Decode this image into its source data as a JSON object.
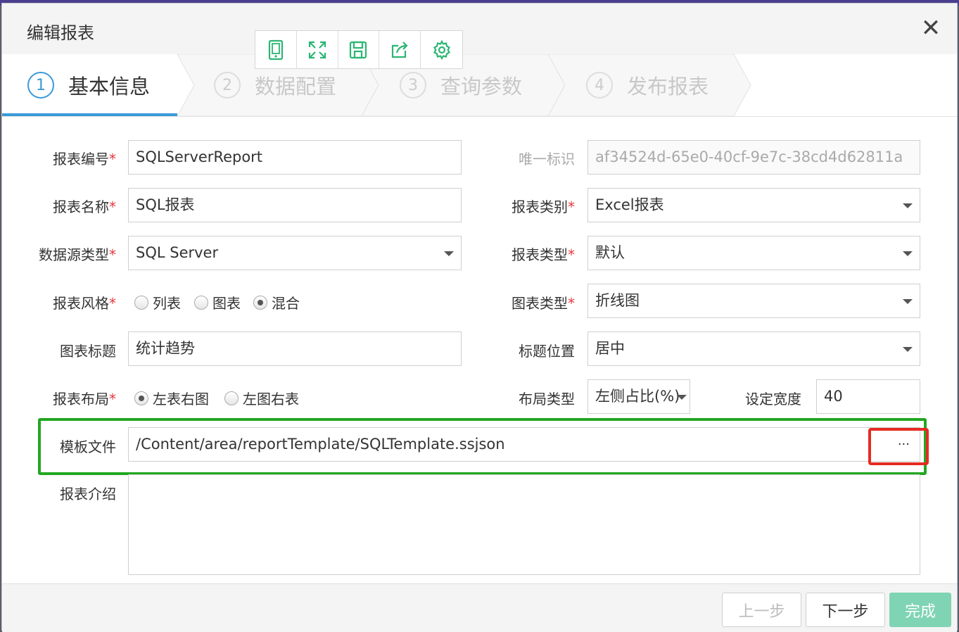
{
  "dialog": {
    "title": "编辑报表"
  },
  "toolbar": {
    "icons": [
      "tablet-icon",
      "fullscreen-icon",
      "save-icon",
      "share-icon",
      "settings-icon"
    ]
  },
  "steps": [
    {
      "num": "1",
      "label": "基本信息",
      "active": true
    },
    {
      "num": "2",
      "label": "数据配置",
      "active": false
    },
    {
      "num": "3",
      "label": "查询参数",
      "active": false
    },
    {
      "num": "4",
      "label": "发布报表",
      "active": false
    }
  ],
  "form": {
    "report_code": {
      "label": "报表编号",
      "required": "*",
      "value": "SQLServerReport"
    },
    "unique_id": {
      "label": "唯一标识",
      "value": "af34524d-65e0-40cf-9e7c-38cd4d62811a"
    },
    "report_name": {
      "label": "报表名称",
      "required": "*",
      "value": "SQL报表"
    },
    "report_category": {
      "label": "报表类别",
      "required": "*",
      "value": "Excel报表"
    },
    "datasource_type": {
      "label": "数据源类型",
      "required": "*",
      "value": "SQL Server"
    },
    "report_type": {
      "label": "报表类型",
      "required": "*",
      "value": "默认"
    },
    "report_style": {
      "label": "报表风格",
      "required": "*",
      "options": [
        "列表",
        "图表",
        "混合"
      ],
      "selected": "混合"
    },
    "chart_type": {
      "label": "图表类型",
      "required": "*",
      "value": "折线图"
    },
    "chart_title": {
      "label": "图表标题",
      "value": "统计趋势"
    },
    "title_position": {
      "label": "标题位置",
      "value": "居中"
    },
    "report_layout": {
      "label": "报表布局",
      "required": "*",
      "options": [
        "左表右图",
        "左图右表"
      ],
      "selected": "左表右图"
    },
    "layout_type": {
      "label": "布局类型",
      "value": "左侧占比(%)"
    },
    "set_width": {
      "label": "设定宽度",
      "value": "40"
    },
    "template_file": {
      "label": "模板文件",
      "value": "/Content/area/reportTemplate/SQLTemplate.ssjson",
      "browse": "···"
    },
    "report_intro": {
      "label": "报表介绍",
      "value": ""
    }
  },
  "footer": {
    "prev": "上一步",
    "next": "下一步",
    "finish": "完成"
  },
  "colors": {
    "accent": "#3a9ad9",
    "toolbar_icon": "#2bb673",
    "highlight_green": "#22a722",
    "highlight_red": "#e52b22",
    "finish_btn": "#7fd4b3",
    "required": "#e8373e"
  }
}
